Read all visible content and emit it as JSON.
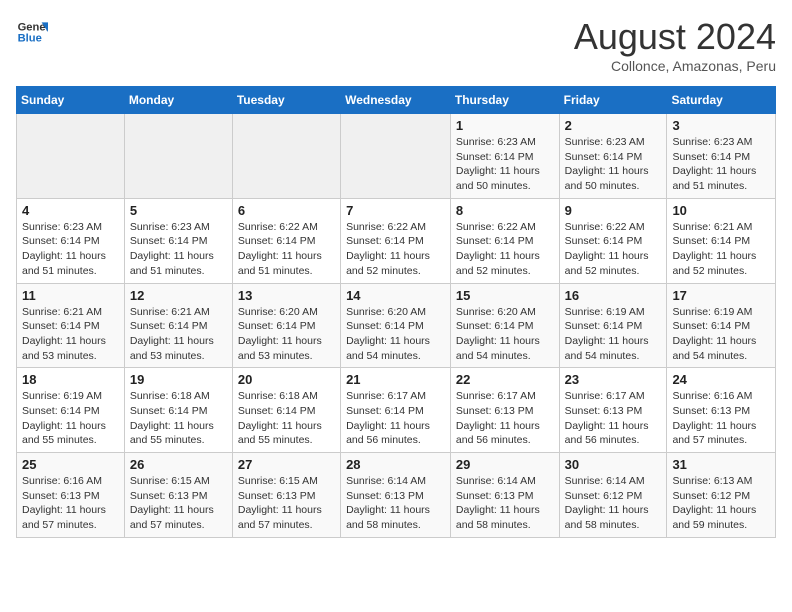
{
  "logo": {
    "line1": "General",
    "line2": "Blue"
  },
  "title": "August 2024",
  "location": "Collonce, Amazonas, Peru",
  "days_of_week": [
    "Sunday",
    "Monday",
    "Tuesday",
    "Wednesday",
    "Thursday",
    "Friday",
    "Saturday"
  ],
  "weeks": [
    [
      {
        "day": "",
        "info": ""
      },
      {
        "day": "",
        "info": ""
      },
      {
        "day": "",
        "info": ""
      },
      {
        "day": "",
        "info": ""
      },
      {
        "day": "1",
        "info": "Sunrise: 6:23 AM\nSunset: 6:14 PM\nDaylight: 11 hours\nand 50 minutes."
      },
      {
        "day": "2",
        "info": "Sunrise: 6:23 AM\nSunset: 6:14 PM\nDaylight: 11 hours\nand 50 minutes."
      },
      {
        "day": "3",
        "info": "Sunrise: 6:23 AM\nSunset: 6:14 PM\nDaylight: 11 hours\nand 51 minutes."
      }
    ],
    [
      {
        "day": "4",
        "info": "Sunrise: 6:23 AM\nSunset: 6:14 PM\nDaylight: 11 hours\nand 51 minutes."
      },
      {
        "day": "5",
        "info": "Sunrise: 6:23 AM\nSunset: 6:14 PM\nDaylight: 11 hours\nand 51 minutes."
      },
      {
        "day": "6",
        "info": "Sunrise: 6:22 AM\nSunset: 6:14 PM\nDaylight: 11 hours\nand 51 minutes."
      },
      {
        "day": "7",
        "info": "Sunrise: 6:22 AM\nSunset: 6:14 PM\nDaylight: 11 hours\nand 52 minutes."
      },
      {
        "day": "8",
        "info": "Sunrise: 6:22 AM\nSunset: 6:14 PM\nDaylight: 11 hours\nand 52 minutes."
      },
      {
        "day": "9",
        "info": "Sunrise: 6:22 AM\nSunset: 6:14 PM\nDaylight: 11 hours\nand 52 minutes."
      },
      {
        "day": "10",
        "info": "Sunrise: 6:21 AM\nSunset: 6:14 PM\nDaylight: 11 hours\nand 52 minutes."
      }
    ],
    [
      {
        "day": "11",
        "info": "Sunrise: 6:21 AM\nSunset: 6:14 PM\nDaylight: 11 hours\nand 53 minutes."
      },
      {
        "day": "12",
        "info": "Sunrise: 6:21 AM\nSunset: 6:14 PM\nDaylight: 11 hours\nand 53 minutes."
      },
      {
        "day": "13",
        "info": "Sunrise: 6:20 AM\nSunset: 6:14 PM\nDaylight: 11 hours\nand 53 minutes."
      },
      {
        "day": "14",
        "info": "Sunrise: 6:20 AM\nSunset: 6:14 PM\nDaylight: 11 hours\nand 54 minutes."
      },
      {
        "day": "15",
        "info": "Sunrise: 6:20 AM\nSunset: 6:14 PM\nDaylight: 11 hours\nand 54 minutes."
      },
      {
        "day": "16",
        "info": "Sunrise: 6:19 AM\nSunset: 6:14 PM\nDaylight: 11 hours\nand 54 minutes."
      },
      {
        "day": "17",
        "info": "Sunrise: 6:19 AM\nSunset: 6:14 PM\nDaylight: 11 hours\nand 54 minutes."
      }
    ],
    [
      {
        "day": "18",
        "info": "Sunrise: 6:19 AM\nSunset: 6:14 PM\nDaylight: 11 hours\nand 55 minutes."
      },
      {
        "day": "19",
        "info": "Sunrise: 6:18 AM\nSunset: 6:14 PM\nDaylight: 11 hours\nand 55 minutes."
      },
      {
        "day": "20",
        "info": "Sunrise: 6:18 AM\nSunset: 6:14 PM\nDaylight: 11 hours\nand 55 minutes."
      },
      {
        "day": "21",
        "info": "Sunrise: 6:17 AM\nSunset: 6:14 PM\nDaylight: 11 hours\nand 56 minutes."
      },
      {
        "day": "22",
        "info": "Sunrise: 6:17 AM\nSunset: 6:13 PM\nDaylight: 11 hours\nand 56 minutes."
      },
      {
        "day": "23",
        "info": "Sunrise: 6:17 AM\nSunset: 6:13 PM\nDaylight: 11 hours\nand 56 minutes."
      },
      {
        "day": "24",
        "info": "Sunrise: 6:16 AM\nSunset: 6:13 PM\nDaylight: 11 hours\nand 57 minutes."
      }
    ],
    [
      {
        "day": "25",
        "info": "Sunrise: 6:16 AM\nSunset: 6:13 PM\nDaylight: 11 hours\nand 57 minutes."
      },
      {
        "day": "26",
        "info": "Sunrise: 6:15 AM\nSunset: 6:13 PM\nDaylight: 11 hours\nand 57 minutes."
      },
      {
        "day": "27",
        "info": "Sunrise: 6:15 AM\nSunset: 6:13 PM\nDaylight: 11 hours\nand 57 minutes."
      },
      {
        "day": "28",
        "info": "Sunrise: 6:14 AM\nSunset: 6:13 PM\nDaylight: 11 hours\nand 58 minutes."
      },
      {
        "day": "29",
        "info": "Sunrise: 6:14 AM\nSunset: 6:13 PM\nDaylight: 11 hours\nand 58 minutes."
      },
      {
        "day": "30",
        "info": "Sunrise: 6:14 AM\nSunset: 6:12 PM\nDaylight: 11 hours\nand 58 minutes."
      },
      {
        "day": "31",
        "info": "Sunrise: 6:13 AM\nSunset: 6:12 PM\nDaylight: 11 hours\nand 59 minutes."
      }
    ]
  ]
}
